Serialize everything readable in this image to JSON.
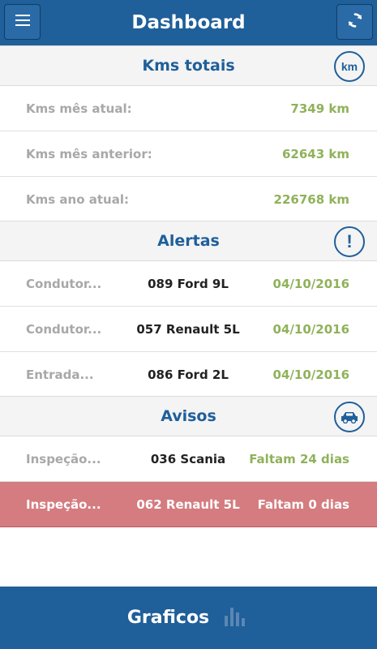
{
  "header": {
    "title": "Dashboard",
    "menu_icon": "hamburger-menu-icon",
    "refresh_icon": "refresh-icon"
  },
  "kms": {
    "title": "Kms totais",
    "icon": "km-icon",
    "icon_text": "km",
    "rows": [
      {
        "label": "Kms mês atual:",
        "value": "7349 km"
      },
      {
        "label": "Kms mês anterior:",
        "value": "62643 km"
      },
      {
        "label": "Kms ano atual:",
        "value": "226768 km"
      }
    ]
  },
  "alertas": {
    "title": "Alertas",
    "icon": "exclamation-icon",
    "icon_text": "!",
    "rows": [
      {
        "type": "Condutor...",
        "vehicle": "089 Ford 9L",
        "date": "04/10/2016"
      },
      {
        "type": "Condutor...",
        "vehicle": "057 Renault 5L",
        "date": "04/10/2016"
      },
      {
        "type": "Entrada...",
        "vehicle": "086 Ford 2L",
        "date": "04/10/2016"
      }
    ]
  },
  "avisos": {
    "title": "Avisos",
    "icon": "car-icon",
    "rows": [
      {
        "type": "Inspeção...",
        "vehicle": "036 Scania",
        "remaining": "Faltam 24 dias",
        "critical": false
      },
      {
        "type": "Inspeção...",
        "vehicle": "062 Renault 5L",
        "remaining": "Faltam 0 dias",
        "critical": true
      }
    ]
  },
  "footer": {
    "label": "Graficos",
    "icon": "bar-chart-icon"
  },
  "colors": {
    "primary": "#1f5f9a",
    "value_green": "#8fb25a",
    "critical_bg": "#d47c80"
  }
}
